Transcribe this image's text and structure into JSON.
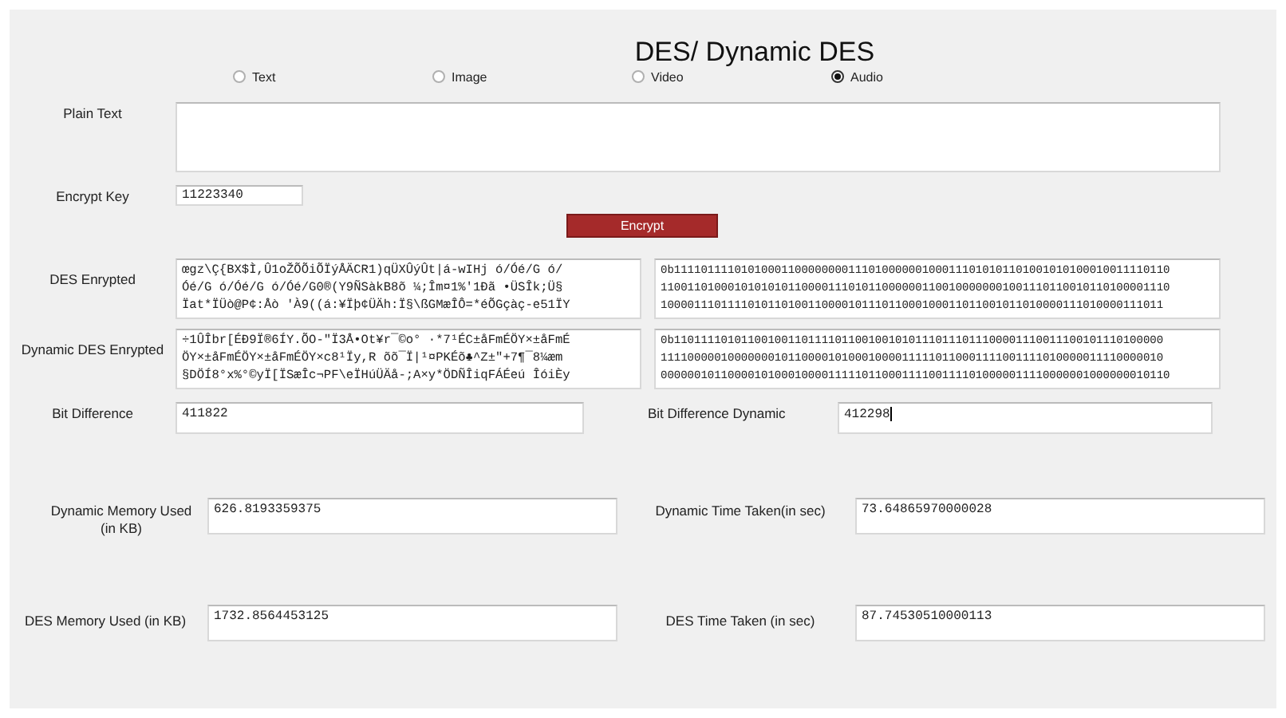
{
  "title": "DES/ Dynamic DES",
  "media_options": [
    {
      "label": "Text",
      "selected": false
    },
    {
      "label": "Image",
      "selected": false
    },
    {
      "label": "Video",
      "selected": false
    },
    {
      "label": "Audio",
      "selected": true
    }
  ],
  "plain_text": {
    "label": "Plain Text"
  },
  "encrypt_key": {
    "label": "Encrypt Key",
    "value": "11223340"
  },
  "encrypt_button": "Encrypt",
  "des_encrypted": {
    "label": "DES Enrypted",
    "text_lines": [
      "œgz\\Ç{BX$Ì,Û1oŽÕÕiÕÏýÅÄCR1)qÜXÛýÛt|á-wIHj ó/Óé/G ó/",
      "Óé/G ó/Óé/G ó/Óé/G0®(Y9ÑSàkB8õ ¼;Îm¤1%'1Ðã •ÜSÎk;Ü§",
      "Ïat*ÏÜò@P¢:Åò 'À9((á:¥Ïþ¢ÜÄh:Ï§\\ßGMæÎÔ=*éÕGçàç-e51ÏY"
    ],
    "binary_lines": [
      "0b11110111101010001100000000111010000001000111010101101001010100010011110110",
      "1100110100010101010110000111010110000001100100000001001110110010110100001110",
      "100001110111101011010011000010111011000100011011001011010000111010000111011"
    ]
  },
  "dynamic_des_encrypted": {
    "label": "Dynamic DES Enrypted",
    "text_lines": [
      "÷1ÛÎbr[ÉÐ9Ï®6ÍY.ÕO-\"Ï3Å•Ot¥r¯©o° ·*7¹ÉC±åFmÉÖY×±åFmÉ",
      "ÖY×±åFmÉÖY×±åFmÉÖY×c8¹Ïy,R õõ¯Ï|¹¤PKÉõ♣^Z±\"+7¶¯8¼æm",
      "§DÖÍ8°x%°©yÏ[ÏSæÎc¬PF\\eÏHúÜÄå-;A×y*ÖDÑÎiqFÁÉeú ÎóiÈy"
    ],
    "binary_lines": [
      "0b1101111010110010011011110110010010101110111011100001110011100101110100000",
      "111100000100000001011000010100010000111110110001111001111010000011110000010",
      "0000001011000010100010000111110110001111001111010000011110000001000000010110"
    ]
  },
  "bit_difference": {
    "label": "Bit Difference",
    "value": "411822"
  },
  "bit_difference_dynamic": {
    "label": "Bit Difference Dynamic",
    "value": "412298"
  },
  "dynamic_memory_used": {
    "label": "Dynamic Memory Used (in KB)",
    "value": "626.8193359375"
  },
  "dynamic_time_taken": {
    "label": "Dynamic Time Taken(in sec)",
    "value": "73.64865970000028"
  },
  "des_memory_used": {
    "label": "DES Memory Used (in KB)",
    "value": "1732.8564453125"
  },
  "des_time_taken": {
    "label": "DES Time Taken (in sec)",
    "value": "87.74530510000113"
  }
}
